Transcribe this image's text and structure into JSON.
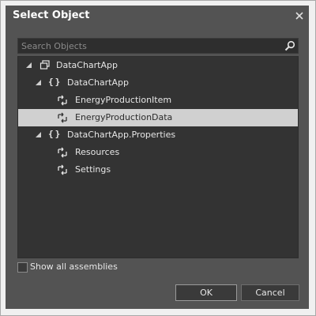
{
  "dialog": {
    "title": "Select Object",
    "close_icon": "close-icon"
  },
  "search": {
    "placeholder": "Search Objects",
    "value": "",
    "icon": "search-icon"
  },
  "tree": {
    "items": [
      {
        "label": "DataChartApp",
        "icon": "assembly-icon",
        "expanded": true,
        "selected": false
      },
      {
        "label": "DataChartApp",
        "icon": "namespace-icon",
        "expanded": true,
        "selected": false
      },
      {
        "label": "EnergyProductionItem",
        "icon": "class-icon",
        "selected": false
      },
      {
        "label": "EnergyProductionData",
        "icon": "class-icon",
        "selected": true
      },
      {
        "label": "DataChartApp.Properties",
        "icon": "namespace-icon",
        "expanded": true,
        "selected": false
      },
      {
        "label": "Resources",
        "icon": "class-icon",
        "selected": false
      },
      {
        "label": "Settings",
        "icon": "class-icon",
        "selected": false
      }
    ]
  },
  "options": {
    "show_all_assemblies_label": "Show all assemblies",
    "show_all_assemblies_checked": false
  },
  "buttons": {
    "ok_label": "OK",
    "cancel_label": "Cancel"
  },
  "colors": {
    "dialog_bg": "#535353",
    "tree_bg": "#333333",
    "selection_bg": "#d0d0d0",
    "text": "#e6e6e6"
  }
}
